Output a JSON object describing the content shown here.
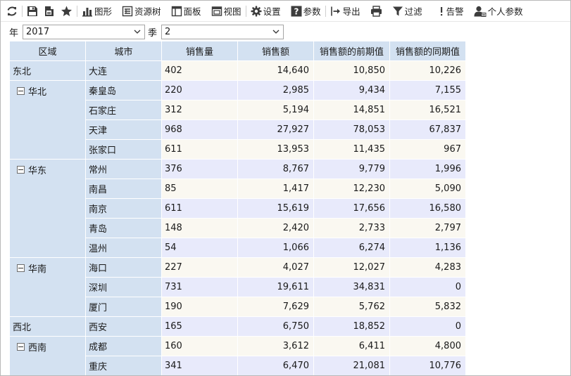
{
  "toolbar": {
    "items": [
      {
        "icon": "refresh-icon",
        "label": ""
      },
      {
        "icon": "save-icon",
        "label": ""
      },
      {
        "icon": "save-as-icon",
        "label": ""
      },
      {
        "icon": "star-icon",
        "label": ""
      },
      {
        "icon": "chart-icon",
        "label": "图形"
      },
      {
        "icon": "resource-tree-icon",
        "label": "资源树"
      },
      {
        "icon": "panel-icon",
        "label": "面板"
      },
      {
        "icon": "view-icon",
        "label": "视图"
      },
      {
        "icon": "gear-icon",
        "label": "设置"
      },
      {
        "icon": "help-icon",
        "label": "参数"
      },
      {
        "icon": "export-icon",
        "label": "导出"
      },
      {
        "icon": "print-icon",
        "label": ""
      },
      {
        "icon": "filter-icon",
        "label": "过滤"
      },
      {
        "icon": "alert-icon",
        "label": "告警"
      },
      {
        "icon": "user-icon",
        "label": "个人参数"
      }
    ]
  },
  "params": {
    "year_label": "年",
    "year_value": "2017",
    "season_label": "季",
    "season_value": "2"
  },
  "table": {
    "headers": [
      "区域",
      "城市",
      "销售量",
      "销售额",
      "销售额的前期值",
      "销售额的同期值"
    ],
    "groups": [
      {
        "region": "东北",
        "collapsible": false,
        "rows": [
          {
            "city": "大连",
            "qty": "402",
            "amount": "14,640",
            "prev": "10,850",
            "same": "10,226"
          }
        ]
      },
      {
        "region": "华北",
        "collapsible": true,
        "rows": [
          {
            "city": "秦皇岛",
            "qty": "220",
            "amount": "2,985",
            "prev": "9,434",
            "same": "7,155"
          },
          {
            "city": "石家庄",
            "qty": "312",
            "amount": "5,194",
            "prev": "14,851",
            "same": "16,521"
          },
          {
            "city": "天津",
            "qty": "968",
            "amount": "27,927",
            "prev": "78,053",
            "same": "67,837"
          },
          {
            "city": "张家口",
            "qty": "611",
            "amount": "13,953",
            "prev": "11,435",
            "same": "967"
          }
        ]
      },
      {
        "region": "华东",
        "collapsible": true,
        "rows": [
          {
            "city": "常州",
            "qty": "376",
            "amount": "8,767",
            "prev": "9,779",
            "same": "1,996"
          },
          {
            "city": "南昌",
            "qty": "85",
            "amount": "1,417",
            "prev": "12,230",
            "same": "5,090"
          },
          {
            "city": "南京",
            "qty": "611",
            "amount": "15,619",
            "prev": "17,656",
            "same": "16,580"
          },
          {
            "city": "青岛",
            "qty": "148",
            "amount": "2,420",
            "prev": "2,733",
            "same": "2,797"
          },
          {
            "city": "温州",
            "qty": "54",
            "amount": "1,066",
            "prev": "6,274",
            "same": "1,136"
          }
        ]
      },
      {
        "region": "华南",
        "collapsible": true,
        "rows": [
          {
            "city": "海口",
            "qty": "227",
            "amount": "4,027",
            "prev": "12,027",
            "same": "4,283"
          },
          {
            "city": "深圳",
            "qty": "731",
            "amount": "19,611",
            "prev": "34,831",
            "same": "0"
          },
          {
            "city": "厦门",
            "qty": "190",
            "amount": "7,629",
            "prev": "5,762",
            "same": "5,832"
          }
        ]
      },
      {
        "region": "西北",
        "collapsible": false,
        "rows": [
          {
            "city": "西安",
            "qty": "165",
            "amount": "6,750",
            "prev": "18,852",
            "same": "0"
          }
        ]
      },
      {
        "region": "西南",
        "collapsible": true,
        "rows": [
          {
            "city": "成都",
            "qty": "160",
            "amount": "3,612",
            "prev": "6,411",
            "same": "4,800"
          },
          {
            "city": "重庆",
            "qty": "341",
            "amount": "6,470",
            "prev": "21,081",
            "same": "10,776"
          }
        ]
      }
    ]
  },
  "colors": {
    "header_bg": "#d3e1f1",
    "row_odd": "#faf8f1",
    "row_even": "#e8eafb",
    "icon": "#3c3c3c"
  }
}
